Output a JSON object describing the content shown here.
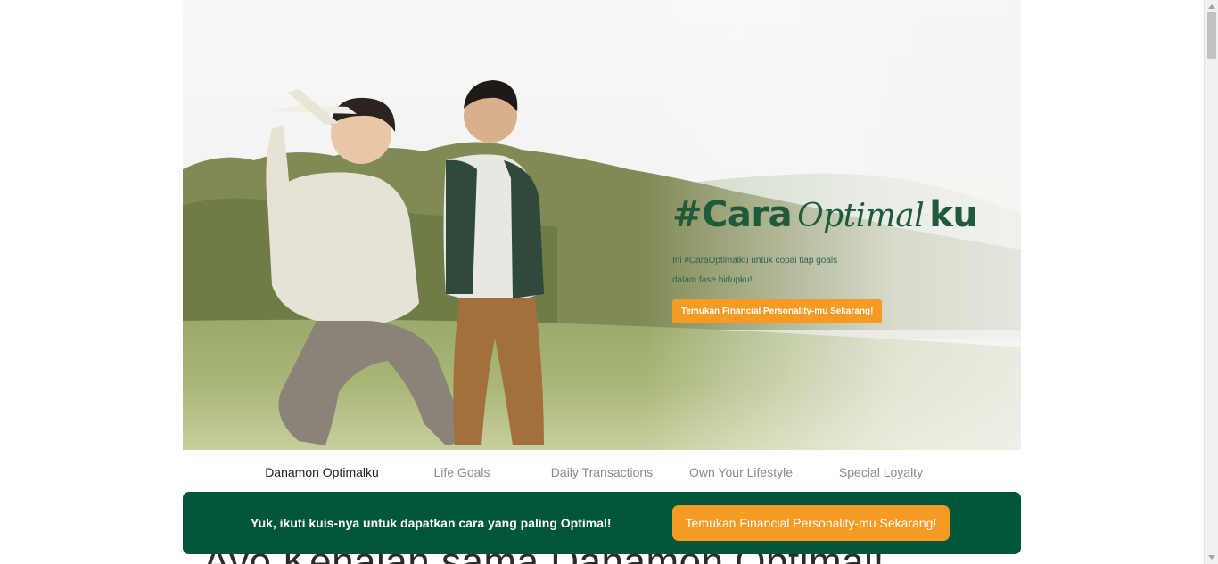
{
  "hero": {
    "title_prefix": "#Cara",
    "title_script": "Optimal",
    "title_suffix": "ku",
    "subtitle": "Ini #CaraOptimalku untuk copai tiap goals dalam fase hidupku!",
    "cta_label": "Temukan Financial Personality-mu Sekarang!",
    "image_description_icon": "father-son-airplane-photo"
  },
  "tabs": [
    {
      "label": "Danamon Optimalku",
      "active": true
    },
    {
      "label": "Life Goals",
      "active": false
    },
    {
      "label": "Daily Transactions",
      "active": false
    },
    {
      "label": "Own Your Lifestyle",
      "active": false
    },
    {
      "label": "Special Loyalty",
      "active": false
    }
  ],
  "section": {
    "heading": "Ayo Kenalan sama Danamon Optimal!"
  },
  "banner": {
    "text": "Yuk, ikuti kuis-nya untuk dapatkan cara yang paling Optimal!",
    "cta_label": "Temukan Financial Personality-mu Sekarang!"
  },
  "colors": {
    "brand_green": "#01553a",
    "accent_orange": "#f59a23",
    "title_green": "#1f5a3a"
  }
}
